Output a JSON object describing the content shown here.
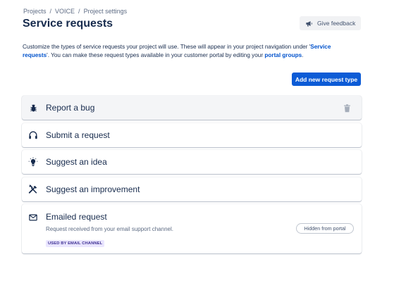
{
  "breadcrumb": [
    "Projects",
    "VOICE",
    "Project settings"
  ],
  "breadcrumb_sep": "/",
  "page_title": "Service requests",
  "feedback_label": "Give feedback",
  "description": {
    "part1": "Customize the types of service requests your project will use. These will appear in your project navigation under '",
    "link1": "Service requests",
    "part2": "'. You can make these request types available in your customer portal by editing your ",
    "link2": "portal groups",
    "part3": "."
  },
  "add_button_label": "Add new request type",
  "request_types": [
    {
      "label": "Report a bug",
      "icon": "bug-icon"
    },
    {
      "label": "Submit a request",
      "icon": "headset-icon"
    },
    {
      "label": "Suggest an idea",
      "icon": "lightbulb-icon"
    },
    {
      "label": "Suggest an improvement",
      "icon": "tools-icon"
    }
  ],
  "email_request": {
    "label": "Emailed request",
    "icon": "envelope-icon",
    "description": "Request received from your email support channel.",
    "badge": "USED BY EMAIL CHANNEL",
    "status": "Hidden from portal"
  },
  "colors": {
    "primary": "#0c5bd6",
    "link": "#0052cc",
    "text": "#172b4d",
    "badge_bg": "#eae6ff",
    "badge_text": "#403294"
  }
}
